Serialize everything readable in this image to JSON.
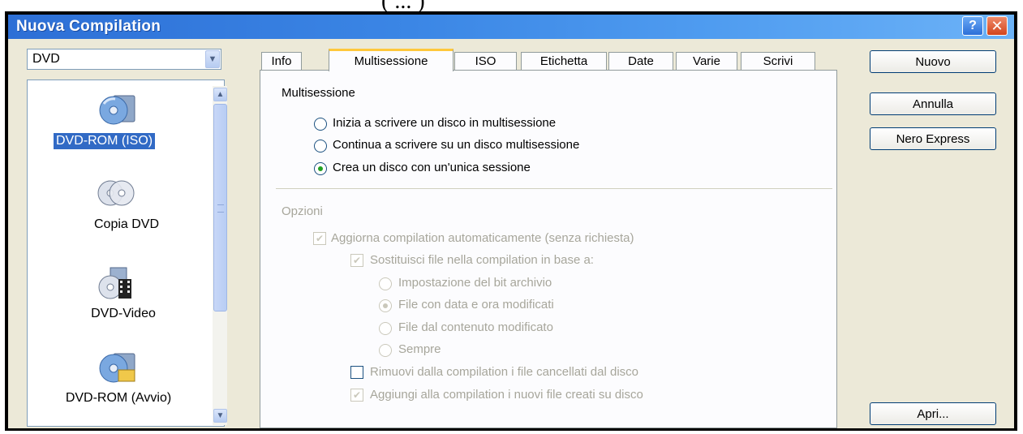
{
  "top_fragment": "( ... )",
  "window": {
    "title": "Nuova Compilation",
    "help_glyph": "?",
    "close_glyph": "✕"
  },
  "media_combo": {
    "value": "DVD"
  },
  "compilations": [
    {
      "label": "DVD-ROM (ISO)",
      "icon": "dvd-rom-iso-icon",
      "selected": true
    },
    {
      "label": "Copia DVD",
      "icon": "copy-dvd-icon"
    },
    {
      "label": "DVD-Video",
      "icon": "dvd-video-icon"
    },
    {
      "label": "DVD-ROM (Avvio)",
      "icon": "dvd-rom-boot-icon"
    }
  ],
  "tabs": [
    {
      "label": "Info"
    },
    {
      "label": "Multisessione",
      "active": true
    },
    {
      "label": "ISO"
    },
    {
      "label": "Etichetta"
    },
    {
      "label": "Date"
    },
    {
      "label": "Varie"
    },
    {
      "label": "Scrivi"
    }
  ],
  "multisession": {
    "heading": "Multisessione",
    "options": [
      {
        "label": "Inizia a scrivere un disco in multisessione",
        "checked": false
      },
      {
        "label": "Continua a scrivere su un disco multisessione",
        "checked": false
      },
      {
        "label": "Crea un disco con un'unica sessione",
        "checked": true
      }
    ]
  },
  "options": {
    "heading": "Opzioni",
    "auto_update": {
      "label": "Aggiorna compilation automaticamente (senza richiesta)",
      "checked": true,
      "enabled": false
    },
    "replace_files": {
      "label": "Sostituisci file nella compilation in base a:",
      "checked": true,
      "enabled": false
    },
    "replace_criteria": [
      {
        "label": "Impostazione del bit archivio",
        "checked": false
      },
      {
        "label": "File con data e ora modificati",
        "checked": true
      },
      {
        "label": "File dal contenuto modificato",
        "checked": false
      },
      {
        "label": "Sempre",
        "checked": false
      }
    ],
    "remove_deleted": {
      "label": "Rimuovi dalla compilation i file cancellati dal disco",
      "checked": false,
      "enabled": true
    },
    "add_new": {
      "label": "Aggiungi alla compilation i nuovi file creati su disco",
      "checked": true,
      "enabled": false
    }
  },
  "buttons": {
    "nuovo": "Nuovo",
    "annulla": "Annulla",
    "nero_express": "Nero Express",
    "apri": "Apri..."
  },
  "colors": {
    "titlebar": "#3b86e5",
    "selection": "#316ac5",
    "active_tab": "#ffc83c",
    "radio_dot": "#21a121"
  }
}
